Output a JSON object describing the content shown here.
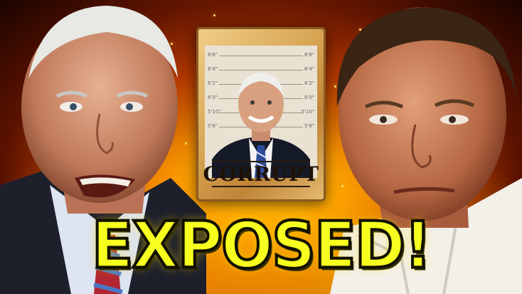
{
  "poster": {
    "title": "CORRUPT",
    "height_marks_left": [
      "6'6\"",
      "6'4\"",
      "6'2\"",
      "6'0\"",
      "5'10\"",
      "5'8\""
    ],
    "height_marks_right": [
      "6'6\"",
      "6'4\"",
      "6'2\"",
      "6'0\"",
      "5'10\"",
      "5'8\""
    ]
  },
  "headline": {
    "text": "EXPOSED!"
  },
  "colors": {
    "headline_fill": "#f6ff1f",
    "headline_outline": "#121000",
    "background_fire": "#ff9a00",
    "poster_paper": "#d9a857"
  }
}
